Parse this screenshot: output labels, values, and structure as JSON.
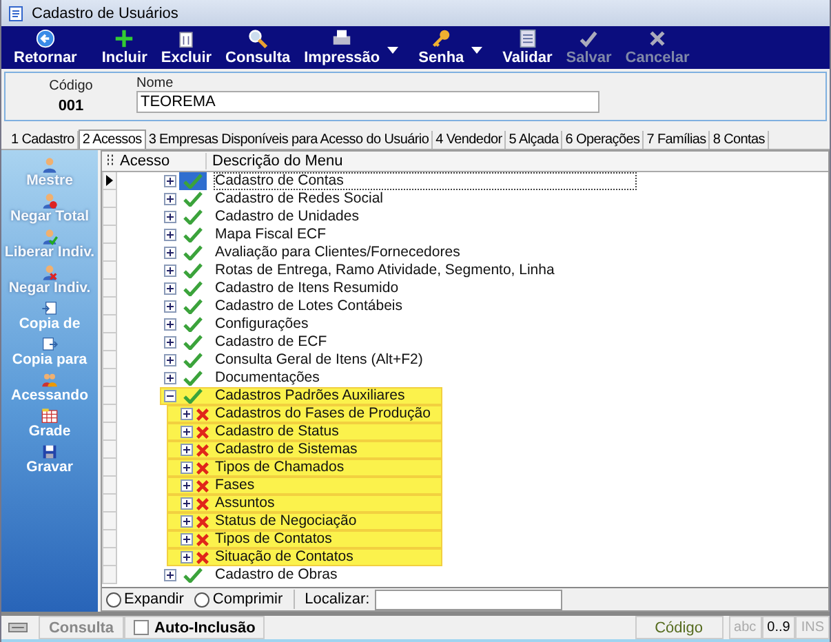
{
  "window": {
    "title": "Cadastro de Usuários"
  },
  "toolbar": [
    {
      "label": "Retornar",
      "kind": "back",
      "disabled": false,
      "dropdown": false
    },
    {
      "label": "Incluir",
      "kind": "add",
      "disabled": false,
      "dropdown": false
    },
    {
      "label": "Excluir",
      "kind": "trash",
      "disabled": false,
      "dropdown": false
    },
    {
      "label": "Consulta",
      "kind": "search",
      "disabled": false,
      "dropdown": false
    },
    {
      "label": "Impressão",
      "kind": "print",
      "disabled": false,
      "dropdown": true
    },
    {
      "label": "Senha",
      "kind": "key",
      "disabled": false,
      "dropdown": true
    },
    {
      "label": "Validar",
      "kind": "sheet",
      "disabled": false,
      "dropdown": false
    },
    {
      "label": "Salvar",
      "kind": "check",
      "disabled": true,
      "dropdown": false
    },
    {
      "label": "Cancelar",
      "kind": "cross",
      "disabled": true,
      "dropdown": false
    }
  ],
  "form": {
    "code_label": "Código",
    "code": "001",
    "name_label": "Nome",
    "name": "TEOREMA"
  },
  "tabs": [
    {
      "label": "1 Cadastro",
      "selected": false
    },
    {
      "label": "2 Acessos",
      "selected": true
    },
    {
      "label": "3 Empresas Disponíveis para Acesso do Usuário",
      "selected": false
    },
    {
      "label": "4 Vendedor",
      "selected": false
    },
    {
      "label": "5 Alçada",
      "selected": false
    },
    {
      "label": "6 Operações",
      "selected": false
    },
    {
      "label": "7 Famílias",
      "selected": false
    },
    {
      "label": "8 Contas",
      "selected": false
    }
  ],
  "sidebar": [
    {
      "label": "Mestre",
      "kind": "person",
      "disabled": true
    },
    {
      "label": "Negar Total",
      "kind": "person-block",
      "disabled": true
    },
    {
      "label": "Liberar Indiv.",
      "kind": "person-check",
      "disabled": true
    },
    {
      "label": "Negar Indiv.",
      "kind": "person-cross",
      "disabled": true
    },
    {
      "label": "Copia de",
      "kind": "copy-in",
      "disabled": false
    },
    {
      "label": "Copia para",
      "kind": "copy-out",
      "disabled": false
    },
    {
      "label": "Acessando",
      "kind": "people",
      "disabled": false
    },
    {
      "label": "Grade",
      "kind": "grid",
      "disabled": false
    },
    {
      "label": "Gravar",
      "kind": "floppy",
      "disabled": false
    }
  ],
  "grid": {
    "columns": [
      "Acesso",
      "Descrição do Menu"
    ],
    "rows": [
      {
        "label": "Cadastro de Contas",
        "granted": true,
        "expanded": false,
        "selected": true,
        "highlighted": false
      },
      {
        "label": "Cadastro de Redes Social",
        "granted": true,
        "expanded": false,
        "selected": false,
        "highlighted": false
      },
      {
        "label": "Cadastro de Unidades",
        "granted": true,
        "expanded": false,
        "selected": false,
        "highlighted": false
      },
      {
        "label": "Mapa Fiscal ECF",
        "granted": true,
        "expanded": false,
        "selected": false,
        "highlighted": false
      },
      {
        "label": "Avaliação para Clientes/Fornecedores",
        "granted": true,
        "expanded": false,
        "selected": false,
        "highlighted": false
      },
      {
        "label": "Rotas de Entrega, Ramo Atividade, Segmento, Linha",
        "granted": true,
        "expanded": false,
        "selected": false,
        "highlighted": false
      },
      {
        "label": "Cadastro de Itens Resumido",
        "granted": true,
        "expanded": false,
        "selected": false,
        "highlighted": false
      },
      {
        "label": "Cadastro de Lotes Contábeis",
        "granted": true,
        "expanded": false,
        "selected": false,
        "highlighted": false
      },
      {
        "label": "Configurações",
        "granted": true,
        "expanded": false,
        "selected": false,
        "highlighted": false
      },
      {
        "label": "Cadastro de ECF",
        "granted": true,
        "expanded": false,
        "selected": false,
        "highlighted": false
      },
      {
        "label": "Consulta Geral de Itens (Alt+F2)",
        "granted": true,
        "expanded": false,
        "selected": false,
        "highlighted": false
      },
      {
        "label": "Documentações",
        "granted": true,
        "expanded": false,
        "selected": false,
        "highlighted": false
      },
      {
        "label": "Cadastros Padrões Auxiliares",
        "granted": true,
        "expanded": true,
        "selected": false,
        "highlighted": true,
        "children": [
          {
            "label": "Cadastros do Fases de Produção",
            "granted": false,
            "expanded": false,
            "selected": false,
            "highlighted": true
          },
          {
            "label": "Cadastro de Status",
            "granted": false,
            "expanded": false,
            "selected": false,
            "highlighted": true
          },
          {
            "label": "Cadastro de Sistemas",
            "granted": false,
            "expanded": false,
            "selected": false,
            "highlighted": true
          },
          {
            "label": "Tipos de Chamados",
            "granted": false,
            "expanded": false,
            "selected": false,
            "highlighted": true
          },
          {
            "label": "Fases",
            "granted": false,
            "expanded": false,
            "selected": false,
            "highlighted": true
          },
          {
            "label": "Assuntos",
            "granted": false,
            "expanded": false,
            "selected": false,
            "highlighted": true
          },
          {
            "label": "Status de Negociação",
            "granted": false,
            "expanded": false,
            "selected": false,
            "highlighted": true
          },
          {
            "label": "Tipos de Contatos",
            "granted": false,
            "expanded": false,
            "selected": false,
            "highlighted": true
          },
          {
            "label": "Situação de Contatos",
            "granted": false,
            "expanded": false,
            "selected": false,
            "highlighted": true
          }
        ]
      },
      {
        "label": "Cadastro de Obras",
        "granted": true,
        "expanded": false,
        "selected": false,
        "highlighted": false
      }
    ]
  },
  "tree_options": [
    {
      "label": "Expandir",
      "selected": false
    },
    {
      "label": "Comprimir",
      "selected": false
    }
  ],
  "search": {
    "label": "Localizar:"
  },
  "status_bar": {
    "mode": "Consulta",
    "auto_label": "Auto-Inclusão",
    "auto_checked": false,
    "field": "Código",
    "indicators": [
      {
        "label": "abc",
        "on": false
      },
      {
        "label": "0..9",
        "on": true
      },
      {
        "label": "INS",
        "on": false
      }
    ]
  }
}
